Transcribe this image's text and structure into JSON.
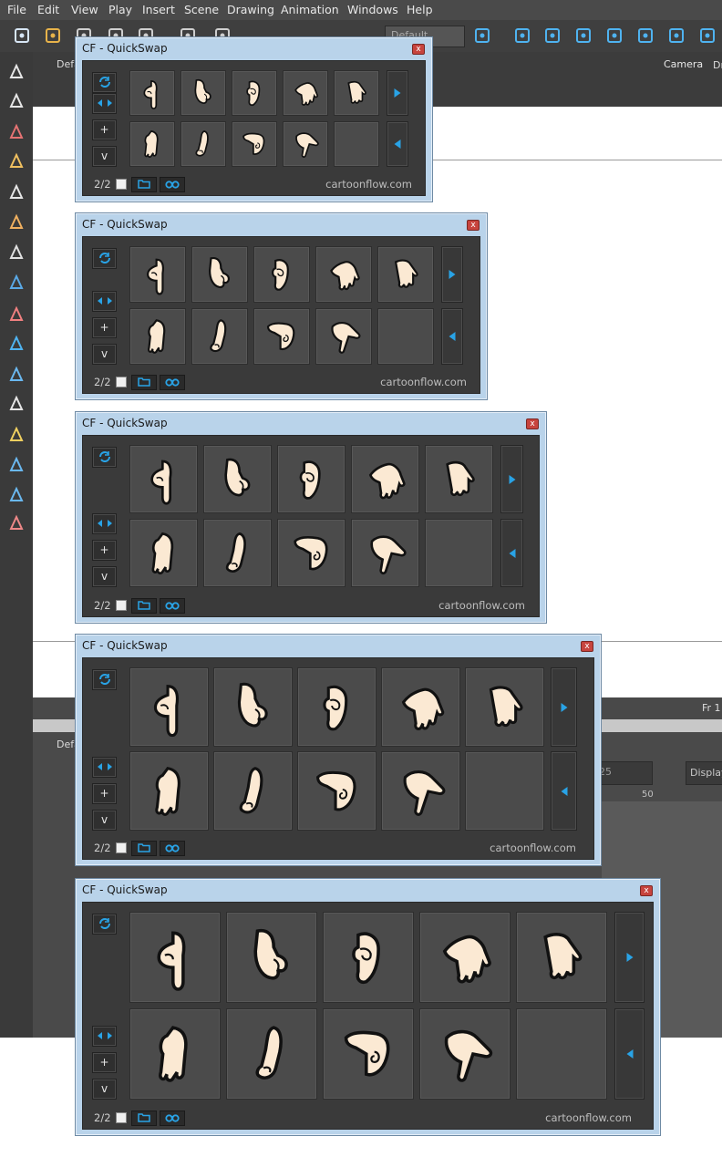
{
  "menu": [
    "File",
    "Edit",
    "View",
    "Play",
    "Insert",
    "Scene",
    "Drawing",
    "Animation",
    "Windows",
    "Help"
  ],
  "toolbar": {
    "preset_value": "Default"
  },
  "view": {
    "tab_label": "Defa",
    "camera_tab": "Camera",
    "second_tab": "Dr"
  },
  "timeline": {
    "tab_label": "Defa",
    "frame_label": "Fr 1",
    "frame_value": "25",
    "ruler_value": "50",
    "display_label": "Display"
  },
  "panel": {
    "title": "CF - QuickSwap",
    "close_label": "x",
    "page_indicator": "2/2",
    "website": "cartoonflow.com",
    "controls": {
      "add_label": "+",
      "down_label": "v"
    },
    "icons": {
      "refresh": "refresh-icon",
      "swap": "swap-arrows-icon",
      "folder": "folder-icon",
      "binoculars": "binoculars-icon"
    },
    "next_label": "next-page",
    "prev_label": "previous-page"
  },
  "hand_poses": [
    "point-down",
    "curled-fingers",
    "fist-knuckle",
    "open-hand-spread",
    "open-hand-relaxed",
    "flat-hand-down",
    "side-hand",
    "curled-point",
    "point-down-diagonal",
    "empty"
  ],
  "colors": {
    "panel_frame": "#b9d3ea",
    "panel_body": "#3a3a3a",
    "slot": "#4b4b4b",
    "accent_blue": "#29a3e6",
    "hand_fill": "#fbe9d3",
    "close_red": "#c7443e"
  }
}
